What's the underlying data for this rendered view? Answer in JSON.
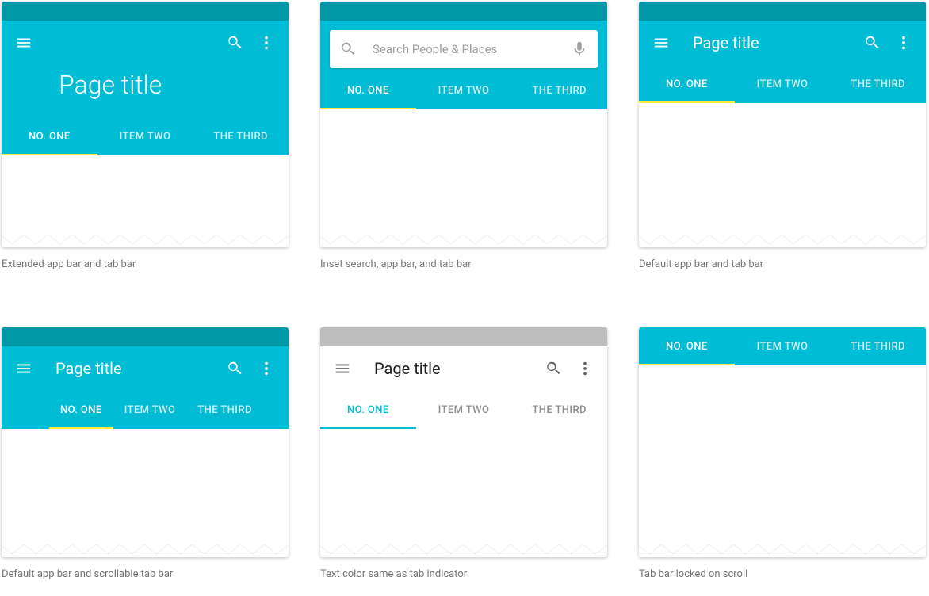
{
  "colors": {
    "primary": "#00bcd4",
    "primary_dark": "#0097a7",
    "accent": "#ffeb3b",
    "text_dark": "#212121",
    "text_muted": "#757575",
    "light_status": "#bdbdbd"
  },
  "tabs": [
    "NO. ONE",
    "ITEM TWO",
    "THE THIRD"
  ],
  "page_title": "Page title",
  "search_placeholder": "Search People  & Places",
  "captions": {
    "c1": "Extended app bar and tab bar",
    "c2": "Inset search, app bar, and tab bar",
    "c3": "Default app bar and tab bar",
    "c4": "Default app bar and scrollable tab bar",
    "c5": "Text color same as tab indicator",
    "c6": "Tab bar locked on scroll"
  },
  "icons": {
    "menu": "menu-icon",
    "search": "search-icon",
    "more": "more-vert-icon",
    "mic": "mic-icon"
  }
}
